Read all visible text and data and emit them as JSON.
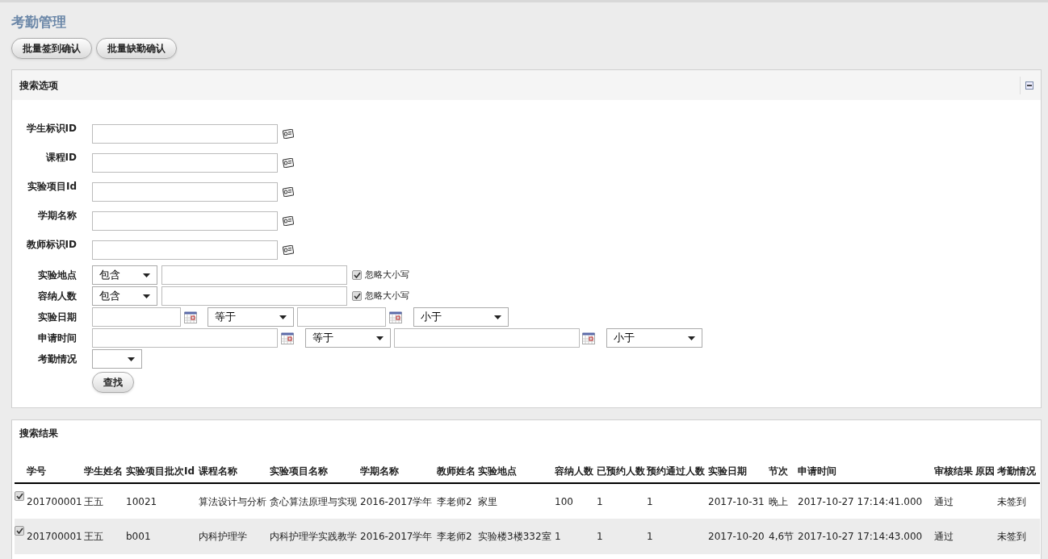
{
  "title": "考勤管理",
  "buttons": [
    "批量签到确认",
    "批量缺勤确认"
  ],
  "search_panel": {
    "title": "搜索选项",
    "expanded": true,
    "fields": [
      {
        "kind": "lookup",
        "label": "学生标识ID"
      },
      {
        "kind": "lookup",
        "label": "课程ID"
      },
      {
        "kind": "lookup",
        "label": "实验项目Id"
      },
      {
        "kind": "lookup",
        "label": "学期名称"
      },
      {
        "kind": "lookup",
        "label": "教师标识ID"
      },
      {
        "kind": "text_filter",
        "label": "实验地点",
        "operator": "包含",
        "ignore_case": {
          "label": "忽略大小写",
          "checked": true
        }
      },
      {
        "kind": "text_filter",
        "label": "容纳人数",
        "operator": "包含",
        "ignore_case": {
          "label": "忽略大小写",
          "checked": true
        }
      },
      {
        "kind": "date_range",
        "label": "实验日期",
        "from_operator": "等于",
        "to_operator": "小于"
      },
      {
        "kind": "datetime_range",
        "label": "申请时间",
        "from_operator": "等于",
        "to_operator": "小于"
      },
      {
        "kind": "select",
        "label": "考勤情况"
      }
    ],
    "search_button": "查找"
  },
  "results": {
    "title": "搜索结果",
    "columns": [
      "学号",
      "学生姓名",
      "实验项目批次Id",
      "课程名称",
      "实验项目名称",
      "学期名称",
      "教师姓名",
      "实验地点",
      "容纳人数",
      "已预约人数",
      "预约通过人数",
      "实验日期",
      "节次",
      "申请时间",
      "审核结果",
      "原因",
      "考勤情况"
    ],
    "rows": [
      {
        "checked": true,
        "cells": [
          "201700001",
          "王五",
          "10021",
          "算法设计与分析",
          "贪心算法原理与实现",
          "2016-2017学年",
          "李老师2",
          "家里",
          "100",
          "1",
          "1",
          "2017-10-31",
          "晚上",
          "2017-10-27 17:14:41.000",
          "通过",
          "",
          "未签到"
        ]
      },
      {
        "checked": true,
        "cells": [
          "201700001",
          "王五",
          "b001",
          "内科护理学",
          "内科护理学实践教学",
          "2016-2017学年",
          "李老师2",
          "实验楼3楼332室",
          "1",
          "1",
          "1",
          "2017-10-20",
          "4,6节",
          "2017-10-27 17:14:43.000",
          "通过",
          "",
          "未签到"
        ]
      }
    ]
  }
}
